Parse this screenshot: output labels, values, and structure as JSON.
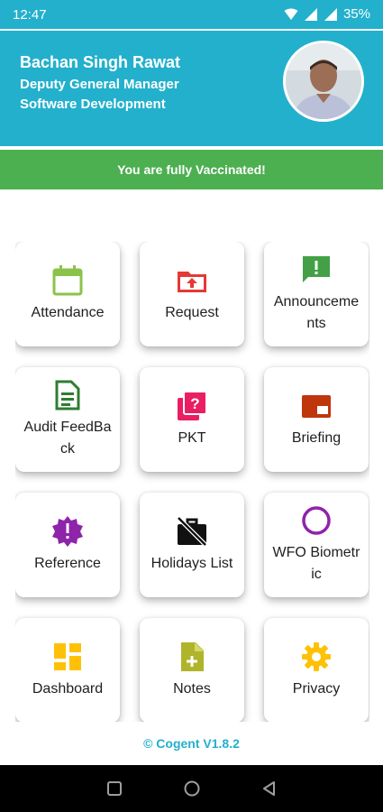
{
  "status_bar": {
    "time": "12:47",
    "battery": "35%"
  },
  "profile": {
    "name": "Bachan Singh Rawat",
    "designation": "Deputy General Manager",
    "department": "Software Development"
  },
  "banner": {
    "text": "You are fully Vaccinated!",
    "color": "#4caf50"
  },
  "menu": [
    {
      "label": "Attendance",
      "icon": "calendar-icon",
      "color": "#8bc34a"
    },
    {
      "label": "Request",
      "icon": "folder-upload-icon",
      "color": "#e53935"
    },
    {
      "label": "Announcements",
      "icon": "announcement-icon",
      "color": "#43a047"
    },
    {
      "label": "Audit FeedBack",
      "icon": "document-icon",
      "color": "#2e7d32"
    },
    {
      "label": "PKT",
      "icon": "quiz-icon",
      "color": "#e91e63"
    },
    {
      "label": "Briefing",
      "icon": "briefing-icon",
      "color": "#bf360c"
    },
    {
      "label": "Reference",
      "icon": "new-releases-icon",
      "color": "#8e24aa"
    },
    {
      "label": "Holidays List",
      "icon": "no-work-icon",
      "color": "#111111"
    },
    {
      "label": "WFO Biometric",
      "icon": "circle-icon",
      "color": "#8e24aa"
    },
    {
      "label": "Dashboard",
      "icon": "dashboard-icon",
      "color": "#ffc107"
    },
    {
      "label": "Notes",
      "icon": "note-add-icon",
      "color": "#afb42b"
    },
    {
      "label": "Privacy",
      "icon": "gear-icon",
      "color": "#ffc107"
    }
  ],
  "footer": {
    "text": "© Cogent V1.8.2"
  },
  "colors": {
    "accent": "#23b0cc",
    "success": "#4caf50"
  }
}
